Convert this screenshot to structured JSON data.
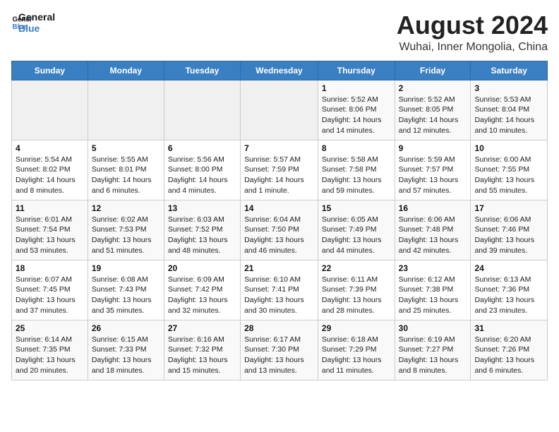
{
  "header": {
    "logo_line1": "General",
    "logo_line2": "Blue",
    "main_title": "August 2024",
    "sub_title": "Wuhai, Inner Mongolia, China"
  },
  "calendar": {
    "days_of_week": [
      "Sunday",
      "Monday",
      "Tuesday",
      "Wednesday",
      "Thursday",
      "Friday",
      "Saturday"
    ],
    "weeks": [
      [
        {
          "day": "",
          "info": ""
        },
        {
          "day": "",
          "info": ""
        },
        {
          "day": "",
          "info": ""
        },
        {
          "day": "",
          "info": ""
        },
        {
          "day": "1",
          "info": "Sunrise: 5:52 AM\nSunset: 8:06 PM\nDaylight: 14 hours and 14 minutes."
        },
        {
          "day": "2",
          "info": "Sunrise: 5:52 AM\nSunset: 8:05 PM\nDaylight: 14 hours and 12 minutes."
        },
        {
          "day": "3",
          "info": "Sunrise: 5:53 AM\nSunset: 8:04 PM\nDaylight: 14 hours and 10 minutes."
        }
      ],
      [
        {
          "day": "4",
          "info": "Sunrise: 5:54 AM\nSunset: 8:02 PM\nDaylight: 14 hours and 8 minutes."
        },
        {
          "day": "5",
          "info": "Sunrise: 5:55 AM\nSunset: 8:01 PM\nDaylight: 14 hours and 6 minutes."
        },
        {
          "day": "6",
          "info": "Sunrise: 5:56 AM\nSunset: 8:00 PM\nDaylight: 14 hours and 4 minutes."
        },
        {
          "day": "7",
          "info": "Sunrise: 5:57 AM\nSunset: 7:59 PM\nDaylight: 14 hours and 1 minute."
        },
        {
          "day": "8",
          "info": "Sunrise: 5:58 AM\nSunset: 7:58 PM\nDaylight: 13 hours and 59 minutes."
        },
        {
          "day": "9",
          "info": "Sunrise: 5:59 AM\nSunset: 7:57 PM\nDaylight: 13 hours and 57 minutes."
        },
        {
          "day": "10",
          "info": "Sunrise: 6:00 AM\nSunset: 7:55 PM\nDaylight: 13 hours and 55 minutes."
        }
      ],
      [
        {
          "day": "11",
          "info": "Sunrise: 6:01 AM\nSunset: 7:54 PM\nDaylight: 13 hours and 53 minutes."
        },
        {
          "day": "12",
          "info": "Sunrise: 6:02 AM\nSunset: 7:53 PM\nDaylight: 13 hours and 51 minutes."
        },
        {
          "day": "13",
          "info": "Sunrise: 6:03 AM\nSunset: 7:52 PM\nDaylight: 13 hours and 48 minutes."
        },
        {
          "day": "14",
          "info": "Sunrise: 6:04 AM\nSunset: 7:50 PM\nDaylight: 13 hours and 46 minutes."
        },
        {
          "day": "15",
          "info": "Sunrise: 6:05 AM\nSunset: 7:49 PM\nDaylight: 13 hours and 44 minutes."
        },
        {
          "day": "16",
          "info": "Sunrise: 6:06 AM\nSunset: 7:48 PM\nDaylight: 13 hours and 42 minutes."
        },
        {
          "day": "17",
          "info": "Sunrise: 6:06 AM\nSunset: 7:46 PM\nDaylight: 13 hours and 39 minutes."
        }
      ],
      [
        {
          "day": "18",
          "info": "Sunrise: 6:07 AM\nSunset: 7:45 PM\nDaylight: 13 hours and 37 minutes."
        },
        {
          "day": "19",
          "info": "Sunrise: 6:08 AM\nSunset: 7:43 PM\nDaylight: 13 hours and 35 minutes."
        },
        {
          "day": "20",
          "info": "Sunrise: 6:09 AM\nSunset: 7:42 PM\nDaylight: 13 hours and 32 minutes."
        },
        {
          "day": "21",
          "info": "Sunrise: 6:10 AM\nSunset: 7:41 PM\nDaylight: 13 hours and 30 minutes."
        },
        {
          "day": "22",
          "info": "Sunrise: 6:11 AM\nSunset: 7:39 PM\nDaylight: 13 hours and 28 minutes."
        },
        {
          "day": "23",
          "info": "Sunrise: 6:12 AM\nSunset: 7:38 PM\nDaylight: 13 hours and 25 minutes."
        },
        {
          "day": "24",
          "info": "Sunrise: 6:13 AM\nSunset: 7:36 PM\nDaylight: 13 hours and 23 minutes."
        }
      ],
      [
        {
          "day": "25",
          "info": "Sunrise: 6:14 AM\nSunset: 7:35 PM\nDaylight: 13 hours and 20 minutes."
        },
        {
          "day": "26",
          "info": "Sunrise: 6:15 AM\nSunset: 7:33 PM\nDaylight: 13 hours and 18 minutes."
        },
        {
          "day": "27",
          "info": "Sunrise: 6:16 AM\nSunset: 7:32 PM\nDaylight: 13 hours and 15 minutes."
        },
        {
          "day": "28",
          "info": "Sunrise: 6:17 AM\nSunset: 7:30 PM\nDaylight: 13 hours and 13 minutes."
        },
        {
          "day": "29",
          "info": "Sunrise: 6:18 AM\nSunset: 7:29 PM\nDaylight: 13 hours and 11 minutes."
        },
        {
          "day": "30",
          "info": "Sunrise: 6:19 AM\nSunset: 7:27 PM\nDaylight: 13 hours and 8 minutes."
        },
        {
          "day": "31",
          "info": "Sunrise: 6:20 AM\nSunset: 7:26 PM\nDaylight: 13 hours and 6 minutes."
        }
      ]
    ]
  }
}
